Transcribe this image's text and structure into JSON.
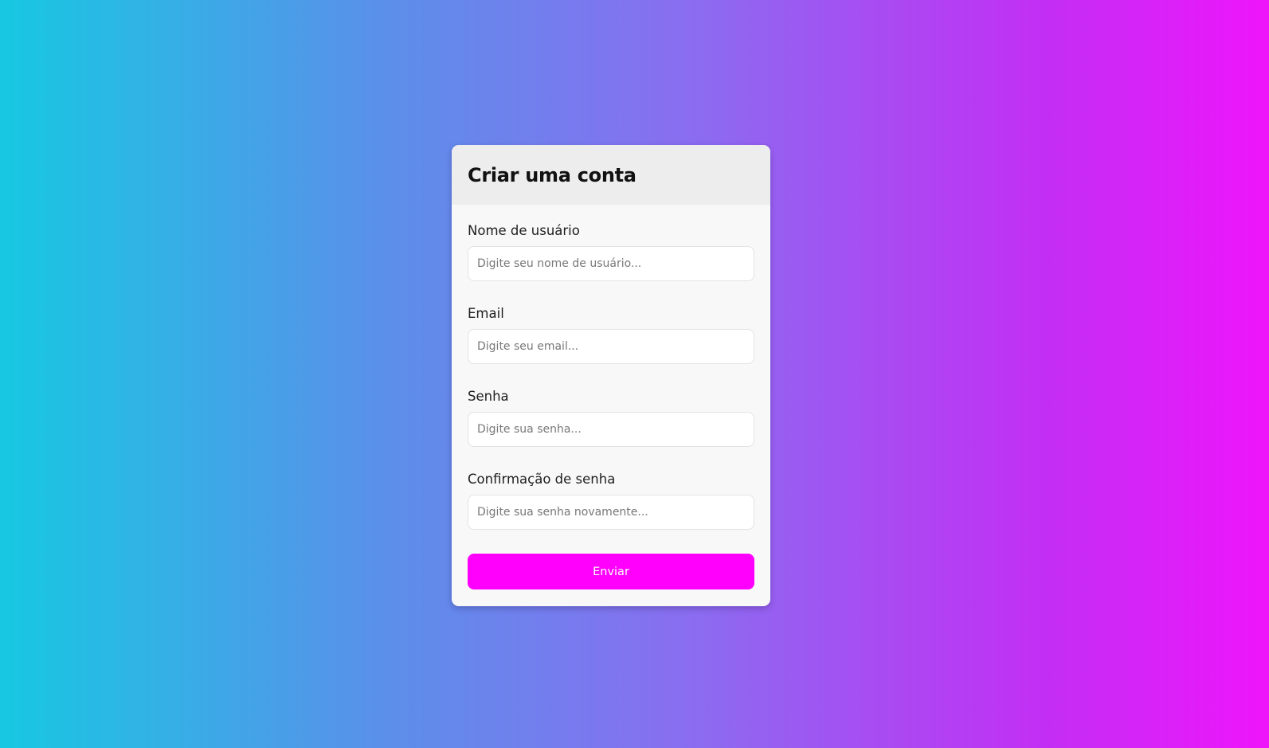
{
  "colors": {
    "background_gradient_start": "#17c8e2",
    "background_gradient_end": "#ee15fb",
    "accent_button": "#ff00fc",
    "card_background": "#f8f8f8",
    "card_header_background": "#ededed"
  },
  "form": {
    "title": "Criar uma conta",
    "fields": [
      {
        "label": "Nome de usuário",
        "placeholder": "Digite seu nome de usuário...",
        "value": ""
      },
      {
        "label": "Email",
        "placeholder": "Digite seu email...",
        "value": ""
      },
      {
        "label": "Senha",
        "placeholder": "Digite sua senha...",
        "value": ""
      },
      {
        "label": "Confirmação de senha",
        "placeholder": "Digite sua senha novamente...",
        "value": ""
      }
    ],
    "submit_label": "Enviar"
  }
}
